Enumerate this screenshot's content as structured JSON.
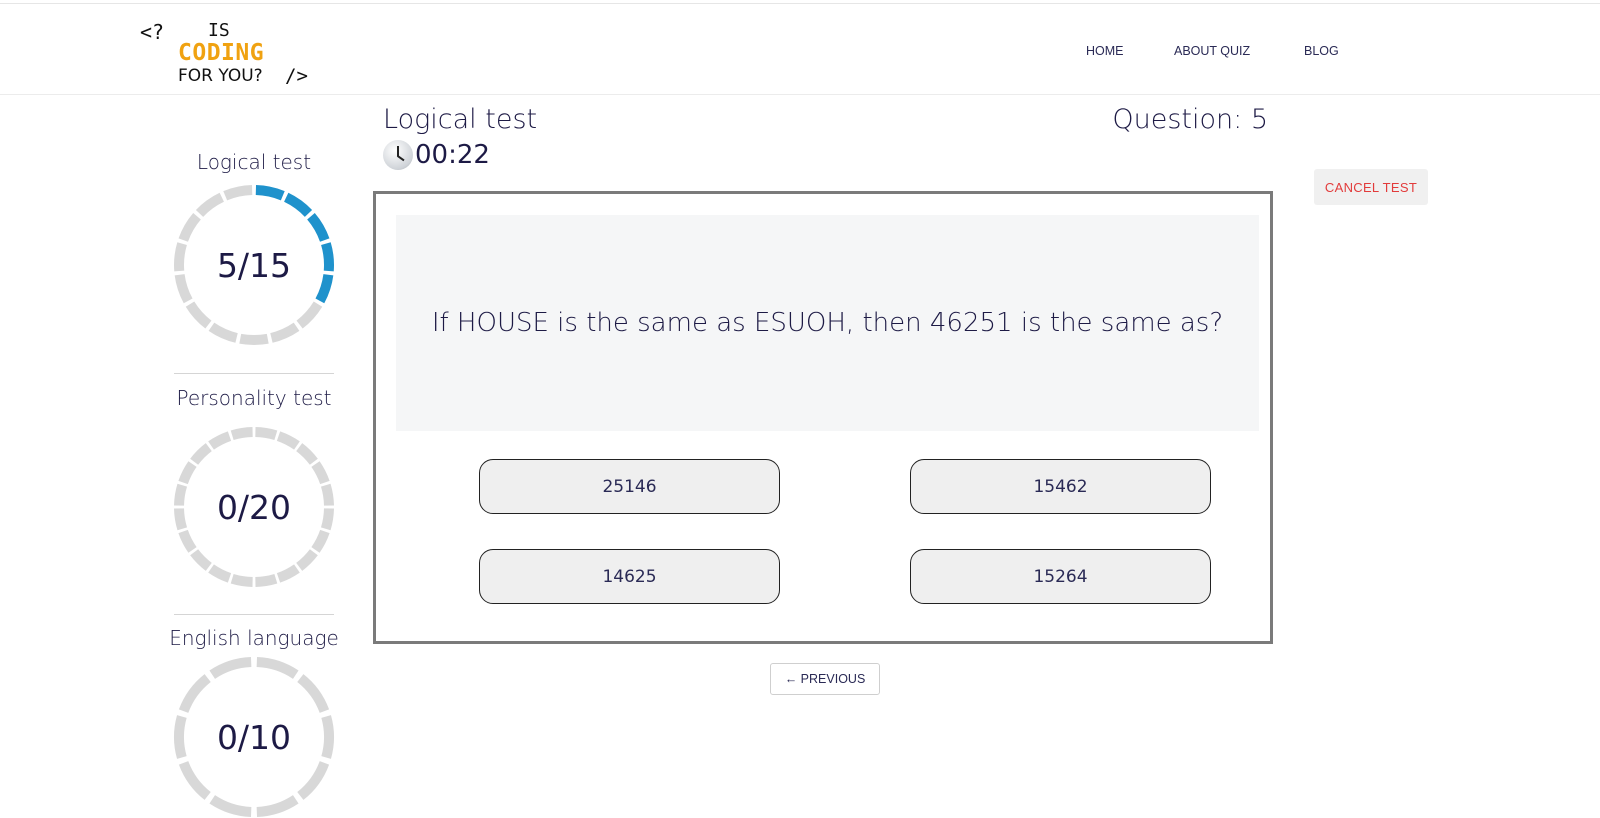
{
  "header": {
    "logo": {
      "line1_left": "<?",
      "line1_right": "IS",
      "line2": "CODING",
      "line3": "FOR YOU?",
      "line3_suffix": "/>"
    },
    "nav": [
      "HOME",
      "ABOUT QUIZ",
      "BLOG"
    ]
  },
  "sidebar": {
    "tests": [
      {
        "title": "Logical test",
        "progress": "5/15",
        "done": 5,
        "total": 15
      },
      {
        "title": "Personality test",
        "progress": "0/20",
        "done": 0,
        "total": 20
      },
      {
        "title": "English language",
        "progress": "0/10",
        "done": 0,
        "total": 10
      }
    ]
  },
  "main": {
    "test_title": "Logical test",
    "timer": "00:22",
    "question_label": "Question: 5",
    "cancel_label": "CANCEL TEST",
    "question": "If HOUSE is the same as ESUOH, then 46251 is the same as?",
    "answers": [
      "25146",
      "15462",
      "14625",
      "15264"
    ],
    "previous_label": "← PREVIOUS"
  },
  "colors": {
    "ring_active": "#1f92cc",
    "ring_inactive": "#d8d8d8",
    "logo_accent": "#f0a211",
    "cancel_text": "#e23b3b"
  }
}
